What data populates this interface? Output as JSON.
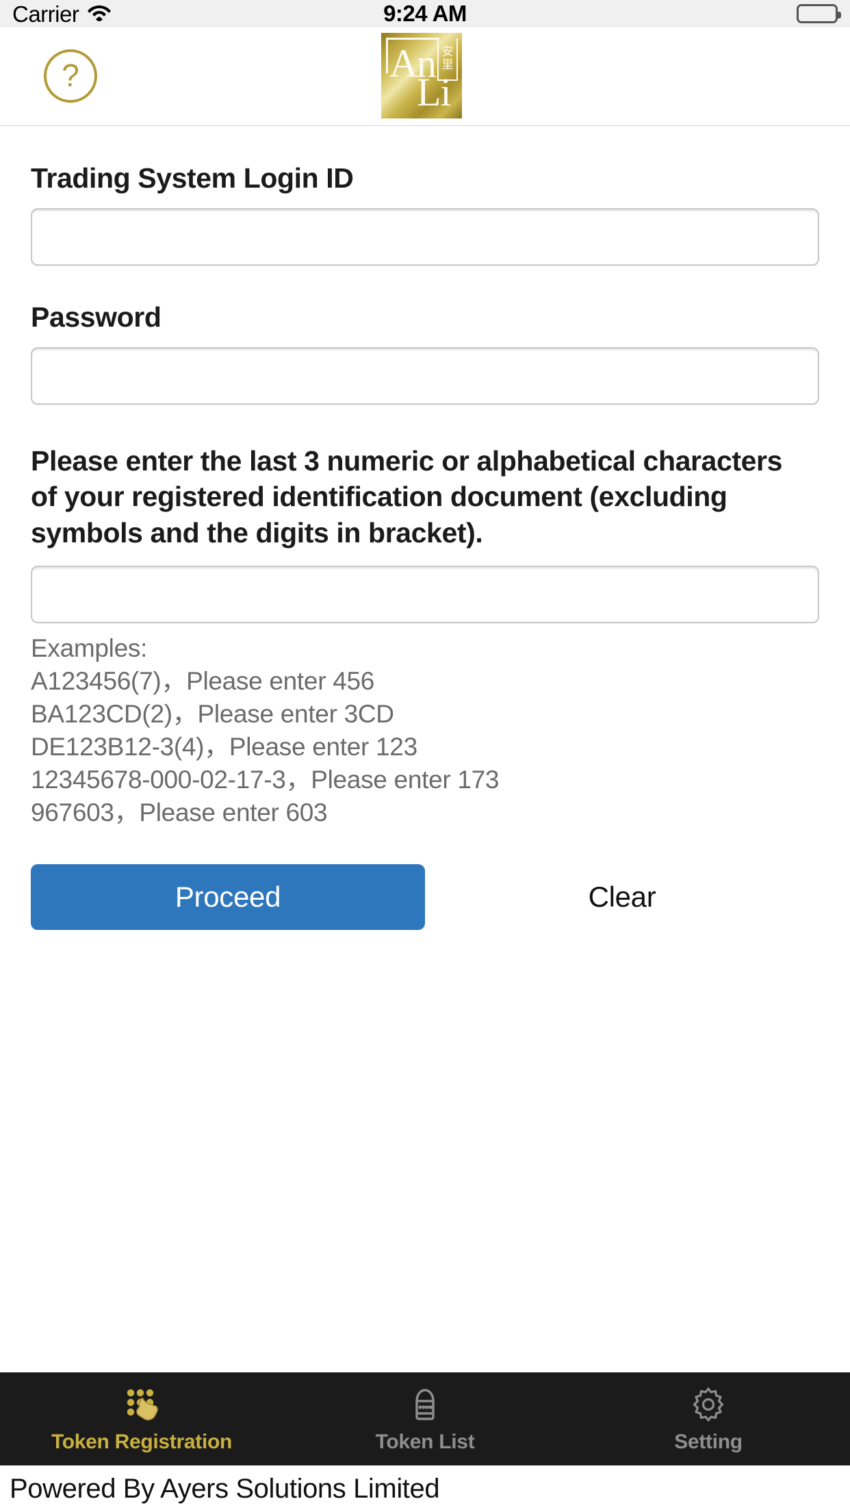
{
  "status_bar": {
    "carrier": "Carrier",
    "time": "9:24 AM",
    "wifi_icon": "wifi-icon",
    "battery_icon": "battery-full-icon"
  },
  "header": {
    "help_icon": "help-question-icon",
    "logo": {
      "line1": "An",
      "line2": "Li",
      "cjk1": "安",
      "cjk2": "里",
      "gold": "#b8a03a"
    }
  },
  "form": {
    "login_id": {
      "label": "Trading System Login ID",
      "value": "",
      "placeholder": ""
    },
    "password": {
      "label": "Password",
      "value": "",
      "placeholder": ""
    },
    "id_last3": {
      "instruction": "Please enter the last 3 numeric or alphabetical characters of your registered identification document (excluding symbols and the digits in bracket).",
      "value": "",
      "placeholder": ""
    },
    "examples": {
      "heading": "Examples:",
      "lines": [
        "A123456(7)，Please enter 456",
        "BA123CD(2)，Please enter 3CD",
        "DE123B12-3(4)，Please enter 123",
        "12345678-000-02-17-3，Please enter 173",
        "967603，Please enter 603"
      ]
    },
    "proceed_label": "Proceed",
    "clear_label": "Clear",
    "proceed_color": "#2e77bd"
  },
  "tab_bar": {
    "active_color": "#c9b03f",
    "inactive_color": "#8e8e8e",
    "items": [
      {
        "label": "Token Registration",
        "icon": "keypad-hand-icon",
        "active": true
      },
      {
        "label": "Token List",
        "icon": "security-token-icon",
        "active": false
      },
      {
        "label": "Setting",
        "icon": "gear-icon",
        "active": false
      }
    ]
  },
  "footer": {
    "text": "Powered By Ayers Solutions Limited"
  }
}
